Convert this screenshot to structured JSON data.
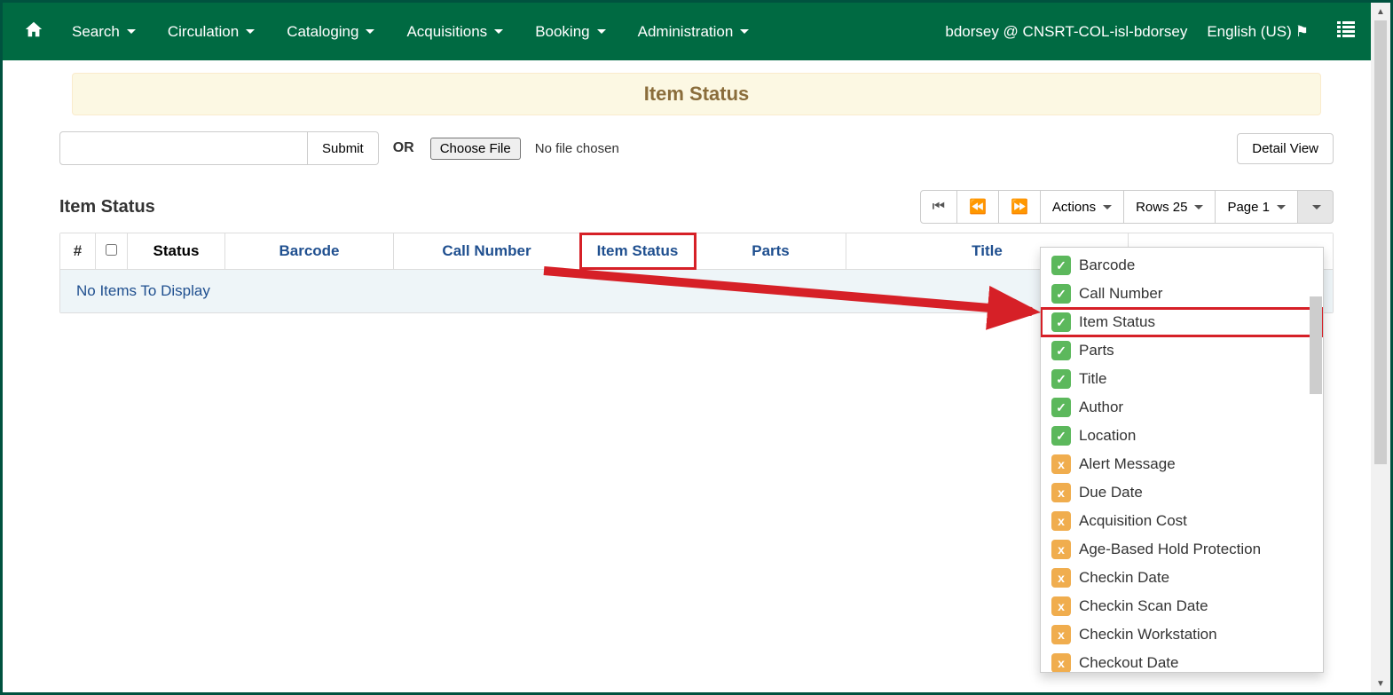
{
  "nav": {
    "items": [
      "Search",
      "Circulation",
      "Cataloging",
      "Acquisitions",
      "Booking",
      "Administration"
    ],
    "user_label": "bdorsey @ CNSRT-COL-isl-bdorsey",
    "lang_label": "English (US)"
  },
  "banner": {
    "title": "Item Status"
  },
  "controls": {
    "submit_label": "Submit",
    "or_label": "OR",
    "file_button_label": "Choose File",
    "file_status": "No file chosen",
    "detail_view_label": "Detail View"
  },
  "section": {
    "title": "Item Status"
  },
  "toolbar": {
    "actions_label": "Actions",
    "rows_label": "Rows 25",
    "page_label": "Page 1"
  },
  "grid": {
    "cols": {
      "hash": "#",
      "status": "Status",
      "barcode": "Barcode",
      "callnum": "Call Number",
      "itemstatus": "Item Status",
      "parts": "Parts",
      "title": "Title"
    },
    "empty_msg": "No Items To Display"
  },
  "columns_menu": [
    {
      "label": "Barcode",
      "on": true
    },
    {
      "label": "Call Number",
      "on": true
    },
    {
      "label": "Item Status",
      "on": true,
      "highlight": true
    },
    {
      "label": "Parts",
      "on": true
    },
    {
      "label": "Title",
      "on": true
    },
    {
      "label": "Author",
      "on": true
    },
    {
      "label": "Location",
      "on": true
    },
    {
      "label": "Alert Message",
      "on": false
    },
    {
      "label": "Due Date",
      "on": false
    },
    {
      "label": "Acquisition Cost",
      "on": false
    },
    {
      "label": "Age-Based Hold Protection",
      "on": false
    },
    {
      "label": "Checkin Date",
      "on": false
    },
    {
      "label": "Checkin Scan Date",
      "on": false
    },
    {
      "label": "Checkin Workstation",
      "on": false
    },
    {
      "label": "Checkout Date",
      "on": false
    }
  ]
}
